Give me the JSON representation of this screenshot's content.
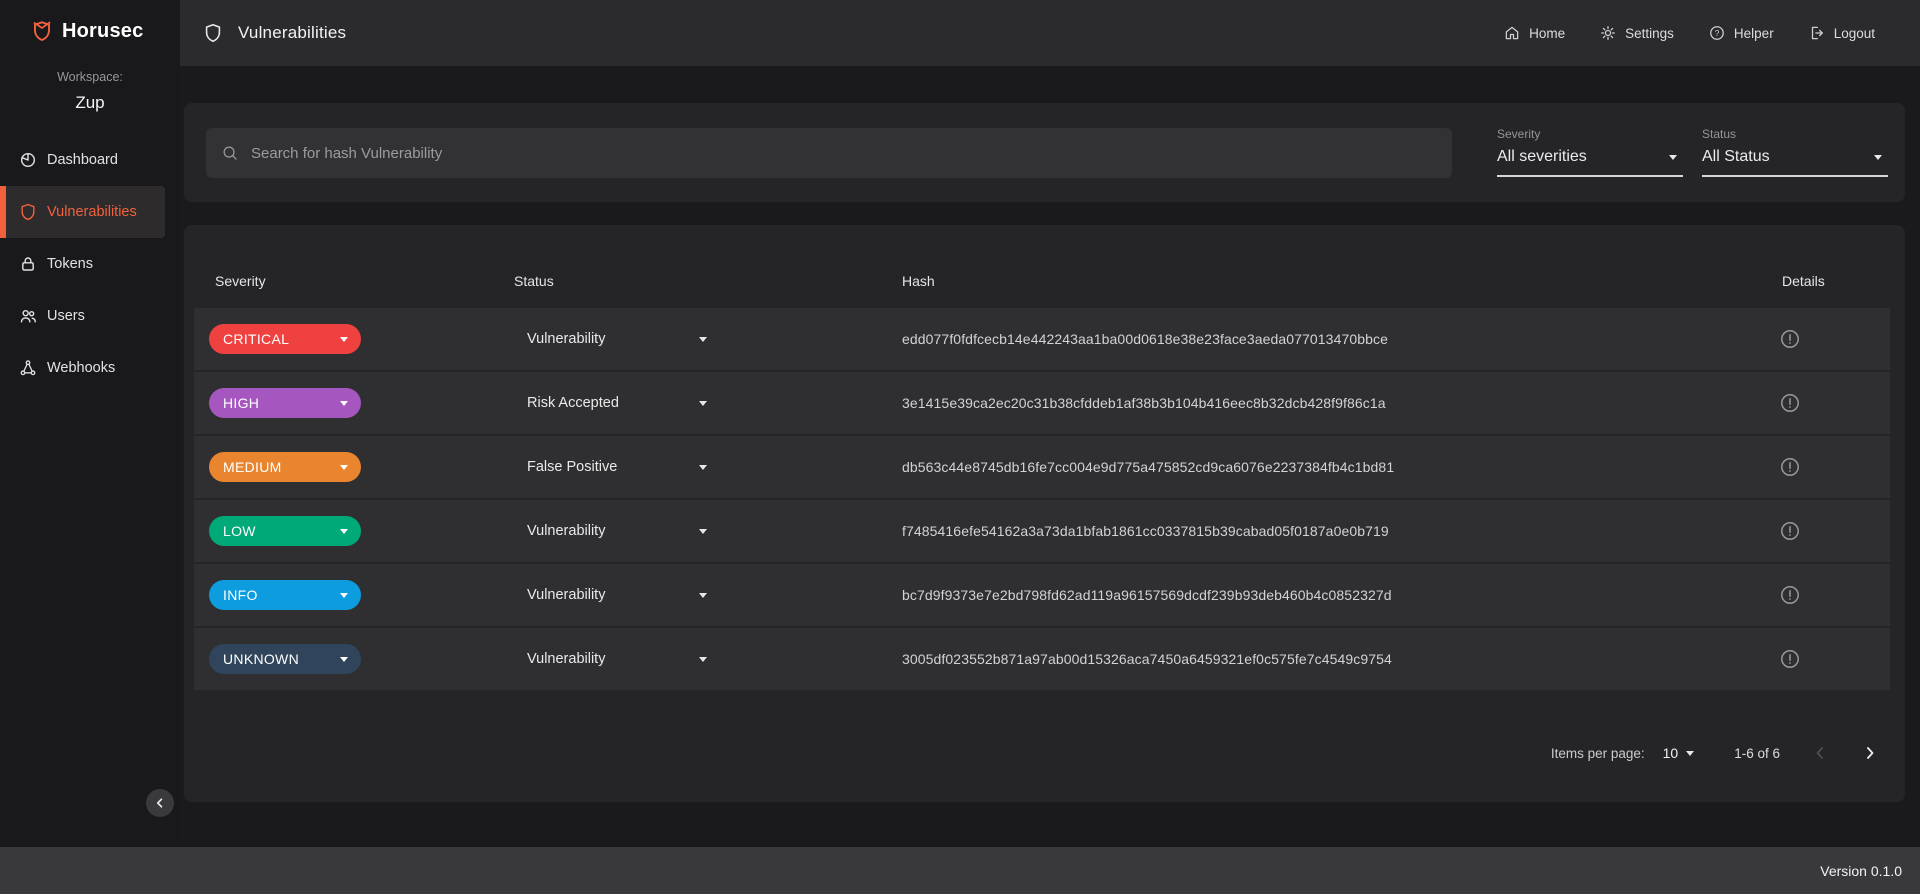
{
  "app": {
    "name": "Horusec",
    "version": "Version 0.1.0"
  },
  "topbar": {
    "title": "Vulnerabilities",
    "nav": [
      {
        "label": "Home",
        "icon": "home-icon"
      },
      {
        "label": "Settings",
        "icon": "gear-icon"
      },
      {
        "label": "Helper",
        "icon": "help-icon",
        "icon_glyph": "?"
      },
      {
        "label": "Logout",
        "icon": "logout-icon"
      }
    ]
  },
  "sidebar": {
    "workspace_label": "Workspace:",
    "workspace_name": "Zup",
    "accent_color": "#F1613D",
    "items": [
      {
        "label": "Dashboard",
        "icon": "pie-chart-icon",
        "active": false
      },
      {
        "label": "Vulnerabilities",
        "icon": "shield-icon",
        "active": true
      },
      {
        "label": "Tokens",
        "icon": "lock-icon",
        "active": false
      },
      {
        "label": "Users",
        "icon": "users-icon",
        "active": false
      },
      {
        "label": "Webhooks",
        "icon": "webhook-icon",
        "active": false
      }
    ]
  },
  "filters": {
    "search_placeholder": "Search for hash Vulnerability",
    "severity": {
      "label": "Severity",
      "value": "All severities"
    },
    "status": {
      "label": "Status",
      "value": "All Status"
    }
  },
  "table": {
    "columns": [
      "Severity",
      "Status",
      "Hash",
      "Details"
    ],
    "rows": [
      {
        "severity": "CRITICAL",
        "severity_color": "#F04141",
        "status": "Vulnerability",
        "hash": "edd077f0fdfcecb14e442243aa1ba00d0618e38e23face3aeda077013470bbce"
      },
      {
        "severity": "HIGH",
        "severity_color": "#A557BF",
        "status": "Risk Accepted",
        "hash": "3e1415e39ca2ec20c31b38cfddeb1af38b3b104b416eec8b32dcb428f9f86c1a"
      },
      {
        "severity": "MEDIUM",
        "severity_color": "#E8852E",
        "status": "False Positive",
        "hash": "db563c44e8745db16fe7cc004e9d775a475852cd9ca6076e2237384fb4c1bd81"
      },
      {
        "severity": "LOW",
        "severity_color": "#00A978",
        "status": "Vulnerability",
        "hash": "f7485416efe54162a3a73da1bfab1861cc0337815b39cabad05f0187a0e0b719"
      },
      {
        "severity": "INFO",
        "severity_color": "#0D9DDF",
        "status": "Vulnerability",
        "hash": "bc7d9f9373e7e2bd798fd62ad119a96157569dcdf239b93deb460b4c0852327d"
      },
      {
        "severity": "UNKNOWN",
        "severity_color": "#30455B",
        "status": "Vulnerability",
        "hash": "3005df023552b871a97ab00d15326aca7450a6459321ef0c575fe7c4549c9754"
      }
    ]
  },
  "pagination": {
    "items_per_page_label": "Items per page:",
    "items_per_page_value": "10",
    "range_label": "1-6 of 6"
  }
}
